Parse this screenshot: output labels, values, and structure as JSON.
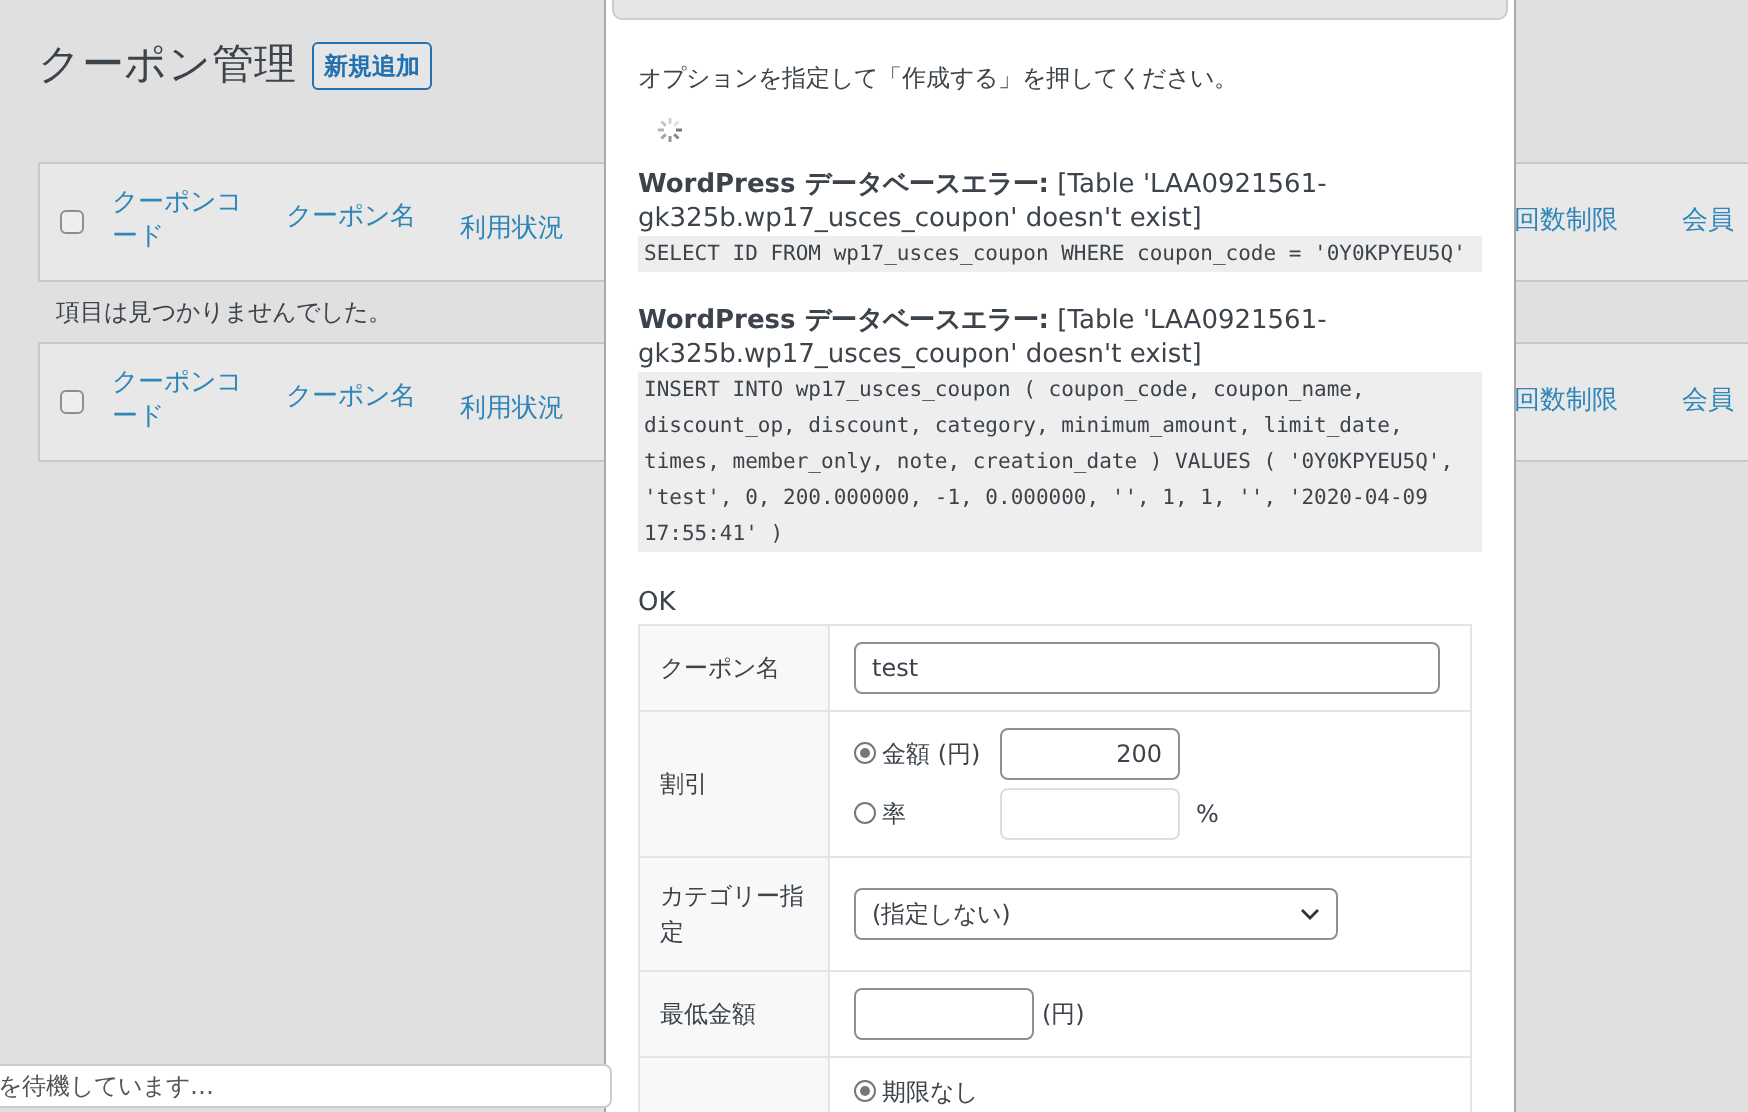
{
  "page": {
    "title": "クーポン管理",
    "add_button": "新規追加",
    "header_row": {
      "checked": false,
      "columns": [
        "クーポンコード",
        "クーポン名",
        "利用状況",
        "回数制限",
        "会員"
      ]
    },
    "empty_message": "項目は見つかりませんでした。",
    "footer_row": {
      "checked": false,
      "columns": [
        "クーポンコード",
        "クーポン名",
        "利用状況",
        "回数制限",
        "会員"
      ]
    }
  },
  "dialog": {
    "instruction": "オプションを指定して「作成する」を押してください。",
    "errors": [
      {
        "label": "WordPress データベースエラー:",
        "message": "[Table 'LAA0921561-gk325b.wp17_usces_coupon' doesn't exist]",
        "query": "SELECT ID FROM wp17_usces_coupon WHERE coupon_code = '0Y0KPYEU5Q'"
      },
      {
        "label": "WordPress データベースエラー:",
        "message": "[Table 'LAA0921561-gk325b.wp17_usces_coupon' doesn't exist]",
        "query": "INSERT INTO wp17_usces_coupon ( coupon_code, coupon_name, discount_op, discount, category, minimum_amount, limit_date, times, member_only, note, creation_date ) VALUES ( '0Y0KPYEU5Q', 'test', 0, 200.000000, -1, 0.000000, '', 1, 1, '', '2020-04-09 17:55:41' )"
      }
    ],
    "result": "OK",
    "form": [
      {
        "kind": "text",
        "label": "クーポン名",
        "value": "test"
      },
      {
        "kind": "radios",
        "label": "割引",
        "options": [
          {
            "label": "金額 (円)",
            "selected": true,
            "value": "200"
          },
          {
            "label": "率",
            "selected": false,
            "suffix": "%"
          }
        ]
      },
      {
        "kind": "select",
        "label": "カテゴリー指定",
        "value": "(指定しない)"
      },
      {
        "kind": "amount",
        "label": "最低金額",
        "suffix": "(円)"
      },
      {
        "kind": "radios",
        "options": [
          {
            "label": "期限なし",
            "selected": true
          }
        ]
      }
    ]
  },
  "status_bar": "を待機しています…"
}
